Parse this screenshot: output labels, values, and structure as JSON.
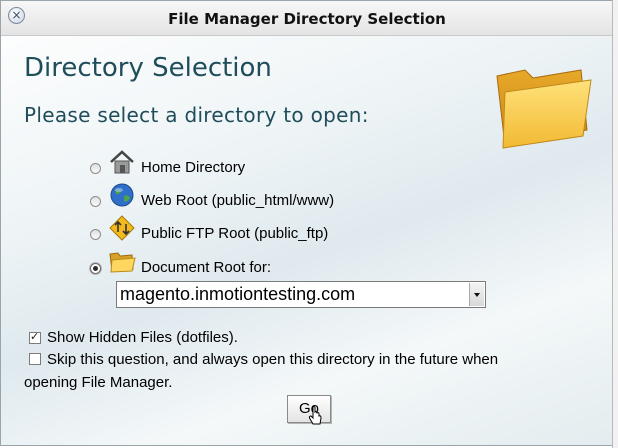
{
  "window": {
    "title": "File Manager Directory Selection"
  },
  "heading": "Directory Selection",
  "subheading": "Please select a directory to open:",
  "options": [
    {
      "label": "Home Directory",
      "icon": "house-icon",
      "selected": false
    },
    {
      "label": "Web Root (public_html/www)",
      "icon": "globe-icon",
      "selected": false
    },
    {
      "label": "Public FTP Root (public_ftp)",
      "icon": "ftp-arrows-icon",
      "selected": false
    },
    {
      "label": "Document Root for:",
      "icon": "open-folder-icon",
      "selected": true
    }
  ],
  "domain_select": {
    "value": "magento.inmotiontesting.com"
  },
  "checkboxes": [
    {
      "label": "Show Hidden Files (dotfiles).",
      "checked": true
    },
    {
      "label": "Skip this question, and always open this directory in the future when",
      "continuation": "opening File Manager.",
      "checked": false
    }
  ],
  "go_button": {
    "label": "Go"
  },
  "colors": {
    "heading": "#1f4d5a",
    "folder": "#f5c842"
  }
}
